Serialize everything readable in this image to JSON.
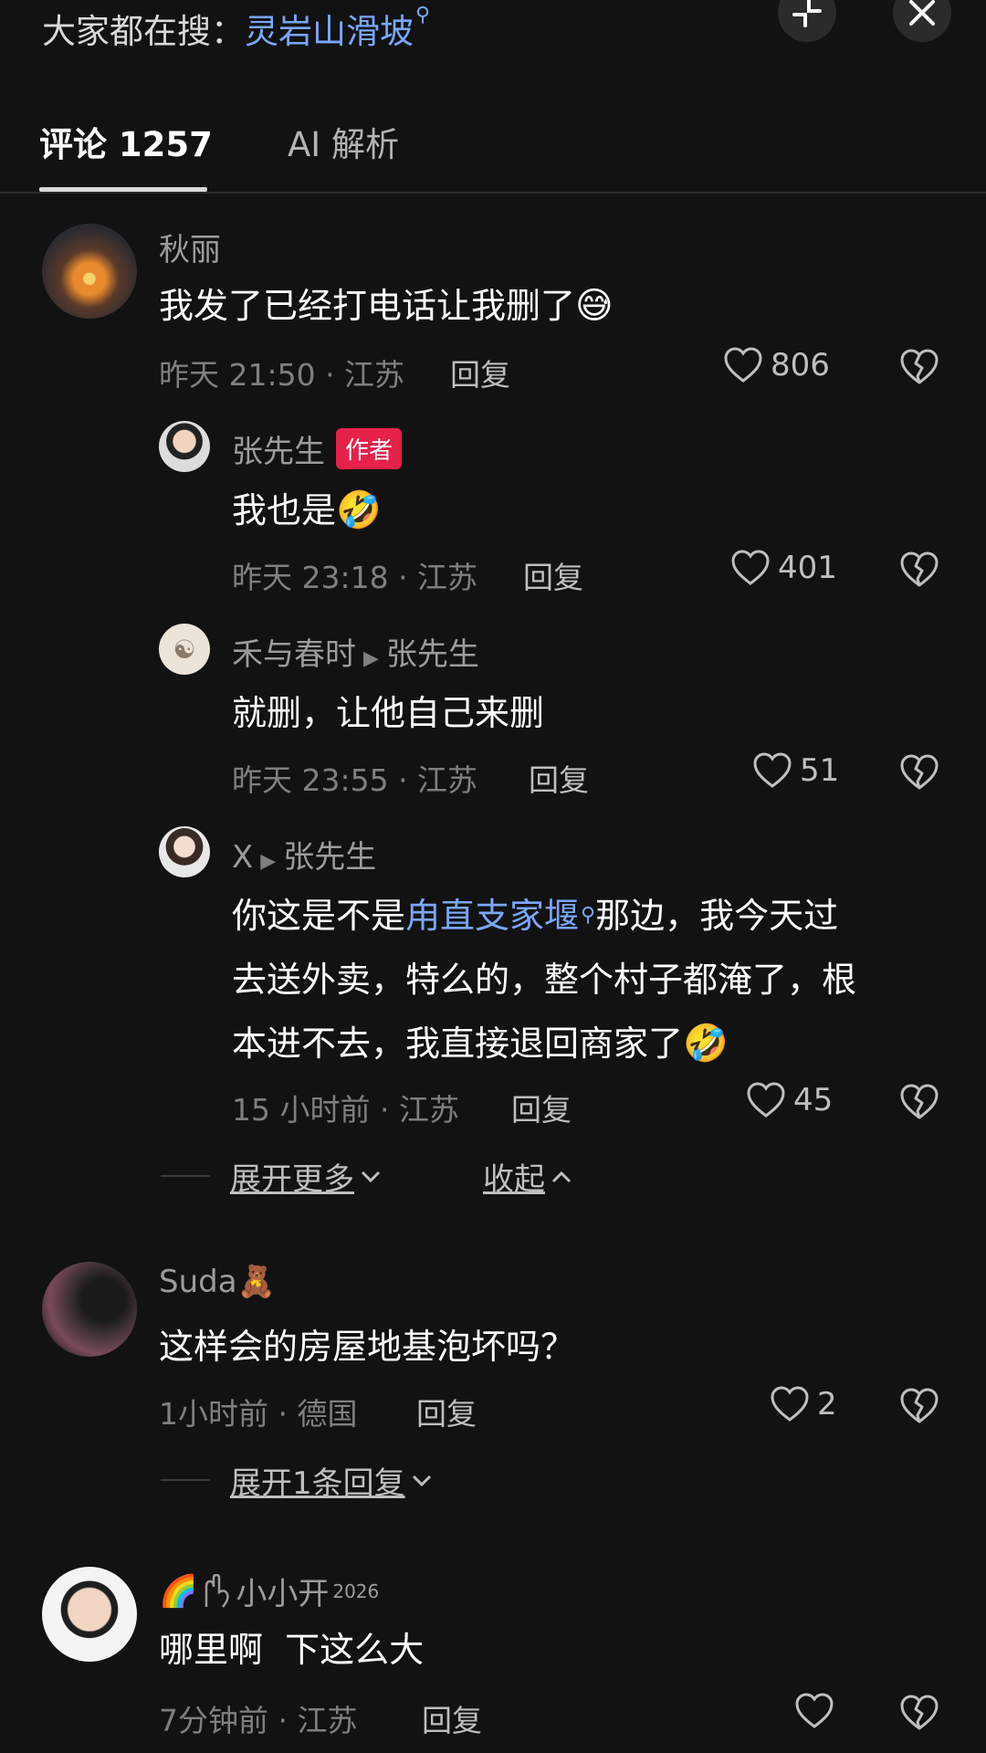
{
  "header": {
    "search_prefix": "大家都在搜：",
    "search_term": "灵岩山滑坡",
    "search_mini_icon": "search-icon"
  },
  "tabs": [
    {
      "label": "评论 1257",
      "active": true
    },
    {
      "label": "AI 解析",
      "active": false
    }
  ],
  "comments": [
    {
      "user": "秋丽",
      "text": "我发了已经打电话让我删了",
      "emoji": "😅",
      "meta": "昨天 21:50 · 江苏",
      "reply_label": "回复",
      "likes": "806"
    },
    {
      "user": "张先生",
      "badge": "作者",
      "text": "我也是",
      "emoji": "🤣",
      "meta": "昨天 23:18 · 江苏",
      "reply_label": "回复",
      "likes": "401"
    },
    {
      "user": "禾与春时",
      "reply_to": "张先生",
      "text": "就删，让他自己来删",
      "meta": "昨天 23:55 · 江苏",
      "reply_label": "回复",
      "likes": "51"
    },
    {
      "user": "X",
      "reply_to": "张先生",
      "text_before": "你这是不是",
      "text_link": "甪直支家堰",
      "text_after_line1": "那边，我今天过",
      "text_line2": "去送外卖，特么的，整个村子都淹了，根",
      "text_line3": "本进不去，我直接退回商家了",
      "emoji": "🤣",
      "meta": "15 小时前 · 江苏",
      "reply_label": "回复",
      "likes": "45"
    },
    {
      "user": "Suda",
      "user_emoji": "🧸",
      "text": "这样会的房屋地基泡坏吗？",
      "meta": "1小时前 · 德国",
      "reply_label": "回复",
      "likes": "2"
    },
    {
      "user_prefix_emoji": "🌈",
      "user": "小小开",
      "user_suffix": "2026",
      "text": "哪里啊  下这么大",
      "meta": "7分钟前 · 江苏",
      "reply_label": "回复",
      "likes": ""
    }
  ],
  "expand": {
    "more_label": "展开更多",
    "collapse_label": "收起",
    "one_reply_label": "展开1条回复"
  },
  "colors": {
    "background": "#121212",
    "link": "#7aa7ff",
    "badge": "#e6214a"
  }
}
